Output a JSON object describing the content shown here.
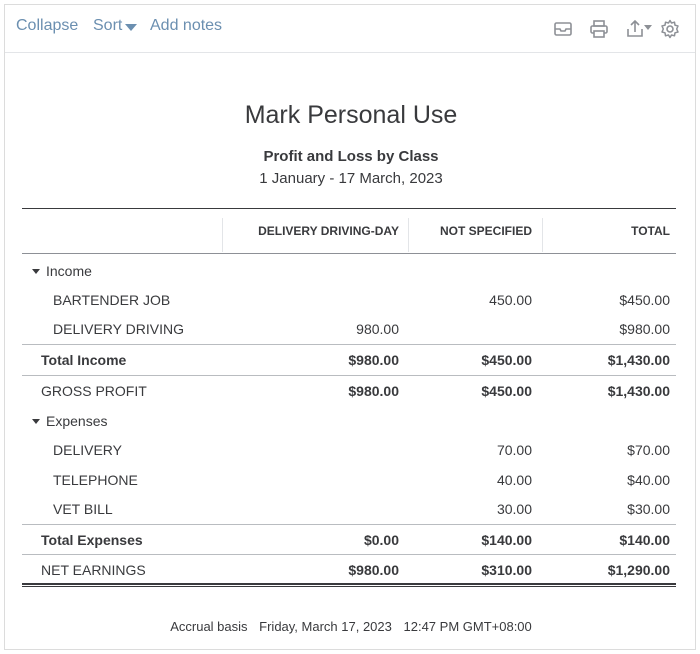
{
  "toolbar": {
    "collapse": "Collapse",
    "sort": "Sort",
    "add_notes": "Add notes",
    "icons": [
      "email-icon",
      "print-icon",
      "export-icon",
      "settings-icon"
    ]
  },
  "report": {
    "company": "Mark Personal Use",
    "name": "Profit and Loss by Class",
    "period": "1 January - 17 March, 2023"
  },
  "columns": [
    "DELIVERY DRIVING-DAY",
    "NOT SPECIFIED",
    "TOTAL"
  ],
  "rows": [
    {
      "label": "Income",
      "values": [
        "",
        "",
        ""
      ]
    },
    {
      "label": "BARTENDER JOB",
      "values": [
        "",
        "450.00",
        "$450.00"
      ]
    },
    {
      "label": "DELIVERY DRIVING",
      "values": [
        "980.00",
        "",
        "$980.00"
      ]
    },
    {
      "label": "Total Income",
      "values": [
        "$980.00",
        "$450.00",
        "$1,430.00"
      ]
    },
    {
      "label": "GROSS PROFIT",
      "values": [
        "$980.00",
        "$450.00",
        "$1,430.00"
      ]
    },
    {
      "label": "Expenses",
      "values": [
        "",
        "",
        ""
      ]
    },
    {
      "label": "DELIVERY",
      "values": [
        "",
        "70.00",
        "$70.00"
      ]
    },
    {
      "label": "TELEPHONE",
      "values": [
        "",
        "40.00",
        "$40.00"
      ]
    },
    {
      "label": "VET BILL",
      "values": [
        "",
        "30.00",
        "$30.00"
      ]
    },
    {
      "label": "Total Expenses",
      "values": [
        "$0.00",
        "$140.00",
        "$140.00"
      ]
    },
    {
      "label": "NET EARNINGS",
      "values": [
        "$980.00",
        "$310.00",
        "$1,290.00"
      ]
    }
  ],
  "footer": {
    "basis": "Accrual basis",
    "date": "Friday, March 17, 2023",
    "time": "12:47 PM GMT+08:00"
  },
  "colors": {
    "link": "#6b8fb0",
    "text": "#393a3d",
    "rule": "#b9bcc0"
  }
}
